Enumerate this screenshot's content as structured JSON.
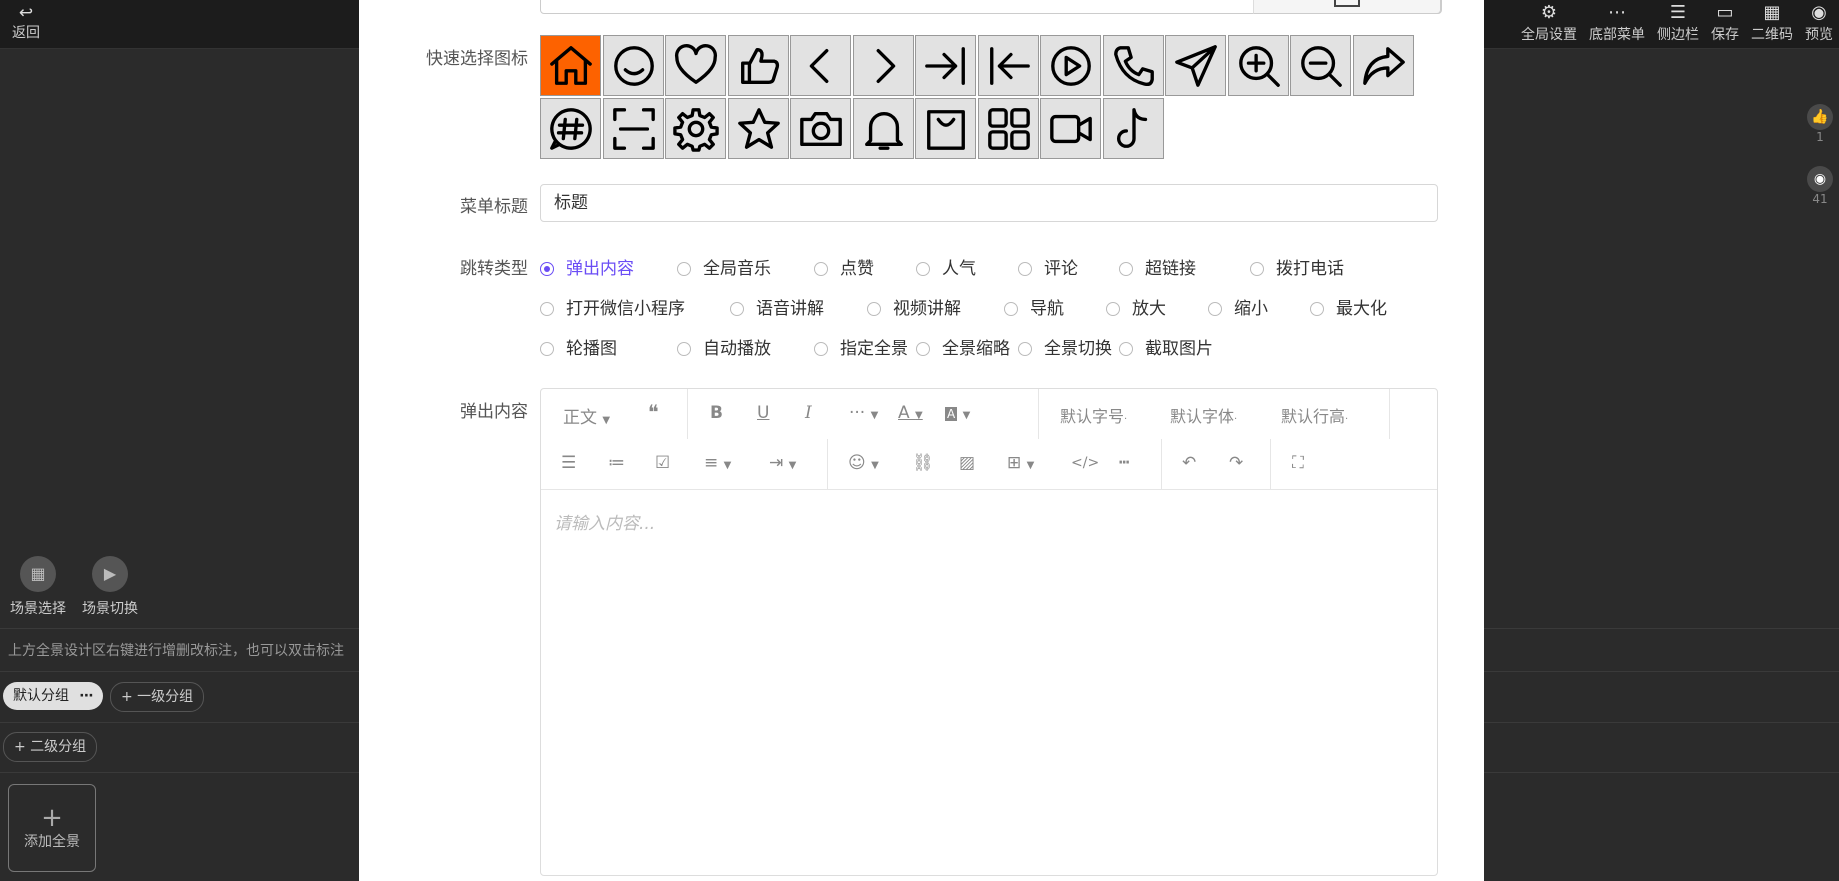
{
  "topbar": {
    "back_icon": "undo-arrow-icon",
    "back_label": "返回",
    "tools": [
      {
        "label": "全局设置",
        "icon": "gear-icon",
        "glyph": "⚙"
      },
      {
        "label": "底部菜单",
        "icon": "more-dots-icon",
        "glyph": "⋯"
      },
      {
        "label": "侧边栏",
        "icon": "list-icon",
        "glyph": "☰"
      },
      {
        "label": "保存",
        "icon": "save-icon",
        "glyph": "▭"
      },
      {
        "label": "二维码",
        "icon": "qrcode-icon",
        "glyph": "▦"
      },
      {
        "label": "预览",
        "icon": "eye-icon",
        "glyph": "◉"
      }
    ]
  },
  "right_side": {
    "like_count": "1",
    "view_count": "41"
  },
  "scene": {
    "select_label": "场景选择",
    "switch_label": "场景切换"
  },
  "hint": "上方全景设计区右键进行增删改标注，也可以双击标注",
  "groups": {
    "default_label": "默认分组",
    "default_more": "⋯",
    "add_level1": "+ 一级分组",
    "add_level2": "+ 二级分组"
  },
  "add_pano": {
    "plus": "+",
    "label": "添加全景"
  },
  "form": {
    "quick_icon_label": "快速选择图标",
    "quick_icons": [
      "home-icon",
      "smile-icon",
      "heart-icon",
      "thumbs-up-icon",
      "chevron-left-icon",
      "chevron-right-icon",
      "arrow-right-bar-icon",
      "arrow-left-bar-icon",
      "play-circle-icon",
      "phone-icon",
      "send-icon",
      "zoom-in-icon",
      "zoom-out-icon",
      "share-icon",
      "hashtag-chat-icon",
      "scan-icon",
      "gear-icon",
      "star-icon",
      "camera-icon",
      "bell-icon",
      "bag-icon",
      "grid-icon",
      "video-icon",
      "tiktok-icon"
    ],
    "menu_title_label": "菜单标题",
    "menu_title_value": "标题",
    "jump_type_label": "跳转类型",
    "jump_types": [
      [
        "弹出内容",
        "全局音乐",
        "点赞",
        "人气",
        "评论",
        "超链接",
        "拨打电话"
      ],
      [
        "打开微信小程序",
        "语音讲解",
        "视频讲解",
        "导航",
        "放大",
        "缩小",
        "最大化"
      ],
      [
        "轮播图",
        "自动播放",
        "指定全景",
        "全景缩略",
        "全景切换",
        "截取图片"
      ]
    ],
    "jump_selected": "弹出内容",
    "popup_label": "弹出内容",
    "editor": {
      "paragraph": "正文",
      "font_size": "默认字号",
      "font_family": "默认字体",
      "line_height": "默认行高",
      "placeholder": "请输入内容..."
    }
  }
}
